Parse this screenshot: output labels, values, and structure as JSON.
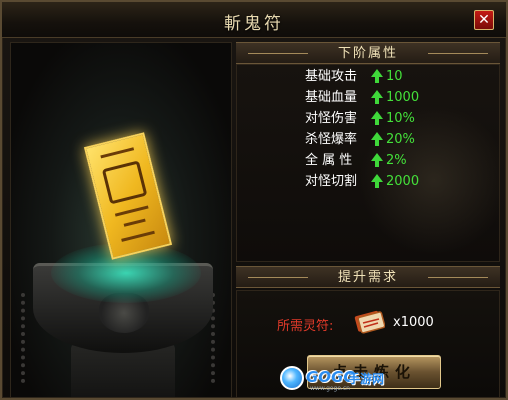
{
  "window": {
    "title": "斬鬼符",
    "close_label": "✕"
  },
  "attributes": {
    "header": "下阶属性",
    "stats": [
      {
        "label": "基础攻击",
        "value": "10"
      },
      {
        "label": "基础血量",
        "value": "1000"
      },
      {
        "label": "对怪伤害",
        "value": "10%"
      },
      {
        "label": "杀怪爆率",
        "value": "20%"
      },
      {
        "label": "全 属 性",
        "value": "2%"
      },
      {
        "label": "对怪切割",
        "value": "2000"
      }
    ]
  },
  "requirement": {
    "header": "提升需求",
    "label": "所需灵符:",
    "item_icon": "talisman-item-icon",
    "count": "x1000",
    "button_label": "点击炼化"
  },
  "logo": {
    "brand": "GOGO",
    "sub": "手游网",
    "url": "www.gogo.cn"
  },
  "colors": {
    "stat_value": "#44e03a",
    "requirement_label": "#e23a2a",
    "title": "#e8d9b0"
  }
}
